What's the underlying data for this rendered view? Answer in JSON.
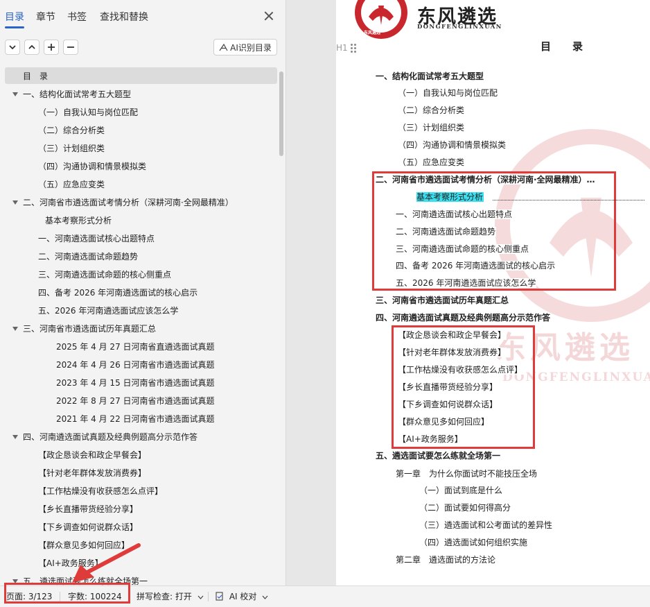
{
  "nav_pane": {
    "tabs": [
      "目录",
      "章节",
      "书签",
      "查找和替换"
    ],
    "active_tab": "目录",
    "ai_button_label": "AI识别目录",
    "toc_items": [
      {
        "text": "目　录",
        "level": 0
      },
      {
        "text": "一、结构化面试常考五大题型",
        "level": 1,
        "expanded": true
      },
      {
        "text": "（一）自我认知与岗位匹配",
        "level": 2
      },
      {
        "text": "（二）综合分析类",
        "level": 2
      },
      {
        "text": "（三）计划组织类",
        "level": 2
      },
      {
        "text": "（四）沟通协调和情景模拟类",
        "level": 2
      },
      {
        "text": "（五）应急应变类",
        "level": 2
      },
      {
        "text": "二、河南省市遴选面试考情分析（深耕河南·全网最精准）",
        "level": 1,
        "expanded": true
      },
      {
        "text": "基本考察形式分析",
        "level": 3
      },
      {
        "text": "一、河南遴选面试核心出题特点",
        "level": 2
      },
      {
        "text": "二、河南遴选面试命题趋势",
        "level": 2
      },
      {
        "text": "三、河南遴选面试命题的核心侧重点",
        "level": 2
      },
      {
        "text": "四、备考 2026 年河南遴选面试的核心启示",
        "level": 2
      },
      {
        "text": "五、2026 年河南遴选面试应该怎么学",
        "level": 2
      },
      {
        "text": "三、河南省市遴选面试历年真题汇总",
        "level": 1,
        "expanded": true
      },
      {
        "text": "2025 年 4 月 27 日河南省直遴选面试真题",
        "level": 4
      },
      {
        "text": "2024 年 4 月 26 日河南省市遴选面试真题",
        "level": 4
      },
      {
        "text": "2023 年 4 月 15 日河南省市遴选面试真题",
        "level": 4
      },
      {
        "text": "2022 年 8 月 27 日河南省市遴选面试真题",
        "level": 4
      },
      {
        "text": "2021 年 4 月 22 日河南省市遴选面试真题",
        "level": 4
      },
      {
        "text": "四、河南遴选面试真题及经典例题高分示范作答",
        "level": 1,
        "expanded": true
      },
      {
        "text": "【政企恳谈会和政企早餐会】",
        "level": 2
      },
      {
        "text": "【针对老年群体发放消费券】",
        "level": 2
      },
      {
        "text": "【工作枯燥没有收获感怎么点评】",
        "level": 2
      },
      {
        "text": "【乡长直播带货经验分享】",
        "level": 2
      },
      {
        "text": "【下乡调查如何说群众话】",
        "level": 2
      },
      {
        "text": "【群众意见多如何回应】",
        "level": 2
      },
      {
        "text": "【AI+政务服务】",
        "level": 2
      },
      {
        "text": "五、遴选面试要怎么练就全场第一",
        "level": 1,
        "expanded": true
      }
    ]
  },
  "status_bar": {
    "page": "页面: 3/123",
    "words": "字数: 100224",
    "spell_check": "拼写检查: 打开",
    "ai_proofread": "AI 校对"
  },
  "document": {
    "brand_name": "东风遴选",
    "brand_pinyin": "DONGFENGLINXUAN",
    "logo_text_top": "DONG FENG LIN XUAN",
    "logo_text_bottom": "东风遴选",
    "watermark_text": "东风遴选",
    "watermark_pinyin": "DONGFENGLINXUAN",
    "heading": "目　录",
    "para_mark": "H1",
    "lines": [
      {
        "text": "一、结构化面试常考五大题型",
        "bold": true
      },
      {
        "text": "（一）自我认知与岗位匹配"
      },
      {
        "text": "（二）综合分析类"
      },
      {
        "text": "（三）计划组织类"
      },
      {
        "text": "（四）沟通协调和情景模拟类"
      },
      {
        "text": "（五）应急应变类"
      },
      {
        "text": "二、河南省市遴选面试考情分析（深耕河南·全网最精准）…",
        "bold": true
      },
      {
        "text": "基本考察形式分析",
        "highlight": true
      },
      {
        "text": "一、河南遴选面试核心出题特点"
      },
      {
        "text": "二、河南遴选面试命题趋势"
      },
      {
        "text": "三、河南遴选面试命题的核心侧重点"
      },
      {
        "text": "四、备考 2026 年河南遴选面试的核心启示"
      },
      {
        "text": "五、2026 年河南遴选面试应该怎么学"
      },
      {
        "text": "三、河南省市遴选面试历年真题汇总",
        "bold": true
      },
      {
        "text": "四、河南遴选面试真题及经典例题高分示范作答",
        "bold": true
      },
      {
        "text": "【政企恳谈会和政企早餐会】"
      },
      {
        "text": "【针对老年群体发放消费券】"
      },
      {
        "text": "【工作枯燥没有收获感怎么点评】"
      },
      {
        "text": "【乡长直播带货经验分享】"
      },
      {
        "text": "【下乡调查如何说群众话】"
      },
      {
        "text": "【群众意见多如何回应】"
      },
      {
        "text": "【AI+政务服务】"
      },
      {
        "text": "五、遴选面试要怎么练就全场第一",
        "bold": true
      },
      {
        "text": "第一章　为什么你面试时不能技压全场"
      },
      {
        "text": "（一）面试到底是什么"
      },
      {
        "text": "（二）面试要如何得高分"
      },
      {
        "text": "（三）遴选面试和公考面试的差异性"
      },
      {
        "text": "（四）遴选面试如何组织实施"
      },
      {
        "text": "第二章　遴选面试的方法论"
      }
    ]
  },
  "colors": {
    "accent_blue": "#2a63c9",
    "annotation_red": "#e03b3b",
    "logo_red": "#c8282d",
    "highlight_cyan": "#3de0f0"
  }
}
